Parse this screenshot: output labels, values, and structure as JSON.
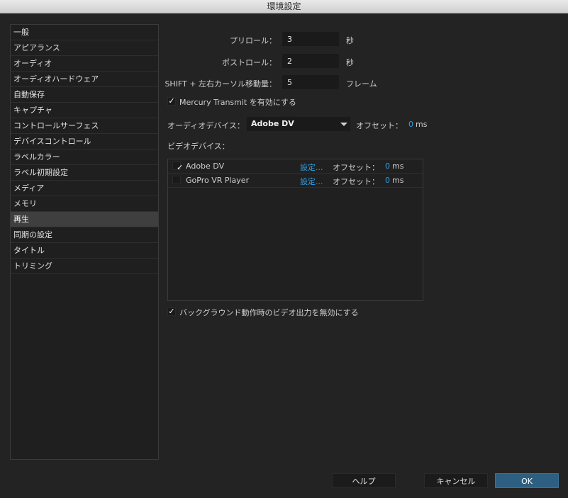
{
  "window": {
    "title": "環境設定"
  },
  "sidebar": {
    "items": [
      "一般",
      "アピアランス",
      "オーディオ",
      "オーディオハードウェア",
      "自動保存",
      "キャプチャ",
      "コントロールサーフェス",
      "デバイスコントロール",
      "ラベルカラー",
      "ラベル初期設定",
      "メディア",
      "メモリ",
      "再生",
      "同期の設定",
      "タイトル",
      "トリミング"
    ],
    "selected": "再生"
  },
  "playback": {
    "preroll": {
      "label": "プリロール：",
      "value": "3",
      "unit": "秒"
    },
    "postroll": {
      "label": "ポストロール：",
      "value": "2",
      "unit": "秒"
    },
    "shift": {
      "label": "SHIFT + 左右カーソル移動量：",
      "value": "5",
      "unit": "フレーム"
    },
    "mercury": {
      "label": "Mercury Transmit を有効にする",
      "checked": true
    },
    "audio_device": {
      "label": "オーディオデバイス：",
      "selected": "Adobe DV",
      "offset_label": "オフセット：",
      "offset_value": "0",
      "offset_unit": "ms"
    },
    "video_devices_label": "ビデオデバイス：",
    "video_devices": [
      {
        "name": "Adobe DV",
        "checked": true,
        "settings": "設定...",
        "offset_label": "オフセット：",
        "offset_value": "0",
        "offset_unit": "ms"
      },
      {
        "name": "GoPro VR Player",
        "checked": false,
        "settings": "設定...",
        "offset_label": "オフセット：",
        "offset_value": "0",
        "offset_unit": "ms"
      }
    ],
    "disable_background": {
      "label": "バックグラウンド動作時のビデオ出力を無効にする",
      "checked": true
    }
  },
  "buttons": {
    "help": "ヘルプ",
    "cancel": "キャンセル",
    "ok": "OK"
  },
  "colors": {
    "accent_blue": "#2d9fe3",
    "ok_button": "#2d5f82"
  }
}
